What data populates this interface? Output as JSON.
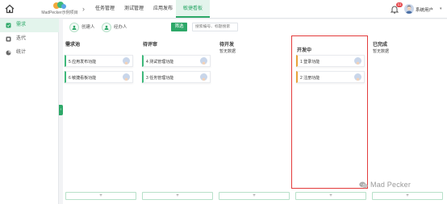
{
  "header": {
    "logo_text": "MadPecker示例项目",
    "nav_tabs": [
      {
        "label": "任务管理",
        "active": false
      },
      {
        "label": "测试管理",
        "active": false
      },
      {
        "label": "应用发布",
        "active": false
      },
      {
        "label": "敏捷看板",
        "active": true
      }
    ],
    "notification_count": "11",
    "user_name": "系统用户"
  },
  "sidebar": {
    "items": [
      {
        "label": "需求",
        "icon": "requirement-icon",
        "active": true
      },
      {
        "label": "迭代",
        "icon": "iteration-icon",
        "active": false
      },
      {
        "label": "统计",
        "icon": "statistics-icon",
        "active": false
      }
    ]
  },
  "filter": {
    "creator_label": "创建人",
    "assignee_label": "经办人",
    "filter_button": "筛选",
    "search_placeholder": "搜索编号、标题搜索"
  },
  "board": {
    "columns": [
      {
        "title": "需求池",
        "accent": "#3db87a",
        "cards": [
          {
            "text": "5 应用发布功能"
          },
          {
            "text": "6 敏捷看板功能"
          }
        ],
        "empty_text": ""
      },
      {
        "title": "待评审",
        "accent": "#3db87a",
        "cards": [
          {
            "text": "4 测试管理功能"
          },
          {
            "text": "3 任务管理功能"
          }
        ],
        "empty_text": ""
      },
      {
        "title": "待开发",
        "accent": "#3db87a",
        "cards": [],
        "empty_text": "暂无数据"
      },
      {
        "title": "开发中",
        "accent": "#e8a33c",
        "cards": [
          {
            "text": "1 登录功能"
          },
          {
            "text": "2 注册功能"
          }
        ],
        "empty_text": ""
      },
      {
        "title": "已完成",
        "accent": "#3db87a",
        "cards": [],
        "empty_text": "暂无数据"
      }
    ],
    "add_label": "+"
  },
  "watermark": {
    "text": "Mad Pecker"
  },
  "colors": {
    "brand": "#2da868",
    "highlight": "#e33b3b",
    "badge": "#e5484d"
  }
}
